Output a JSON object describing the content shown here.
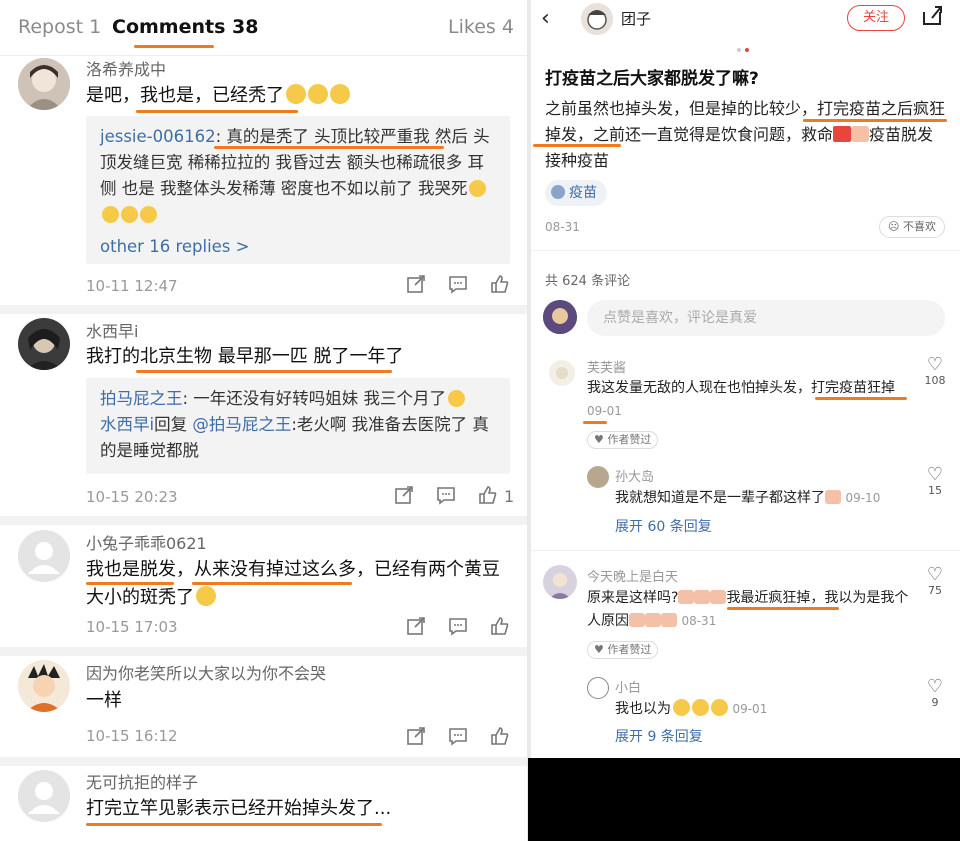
{
  "left": {
    "tabs": {
      "repost": "Repost 1",
      "comments": "Comments 38",
      "likes": "Likes 4"
    },
    "comments": [
      {
        "user": "洛希养成中",
        "text": "是吧，我也是，已经秃了",
        "reply_box": {
          "line1_user": "jessie-006162",
          "line1_text": ": 真的是秃了 头顶比较严重我 然后 头顶发缝巨宽 稀稀拉拉的 我昏过去 额头也稀疏很多 耳侧 也是 我整体头发稀薄 密度也不如以前了 我哭死",
          "more": "other 16 replies >"
        },
        "time": "10-11 12:47"
      },
      {
        "user": "水西早i",
        "text": "我打的北京生物 最早那一匹 脱了一年了",
        "reply_box": {
          "line1_user": "拍马屁之王",
          "line1_text": ": 一年还没有好转吗姐妹 我三个月了",
          "line2_user": "水西早i",
          "line2_mid": "回复",
          "line2_at": "@拍马屁之王",
          "line2_text": ":老火啊 我准备去医院了 真的是睡觉都脱"
        },
        "time": "10-15 20:23",
        "likes": "1"
      },
      {
        "user": "小兔子乖乖0621",
        "text": "我也是脱发，从来没有掉过这么多，已经有两个黄豆大小的斑秃了",
        "time": "10-15 17:03"
      },
      {
        "user": "因为你老笑所以大家以为你不会哭",
        "text": "一样",
        "time": "10-15 16:12"
      },
      {
        "user": "无可抗拒的样子",
        "text": "打完立竿见影表示已经开始掉头发了..."
      }
    ]
  },
  "right": {
    "author": "团子",
    "follow": "关注",
    "title": "打疫苗之后大家都脱发了嘛?",
    "body": "之前虽然也掉头发，但是掉的比较少，打完疫苗之后疯狂掉发，之前还一直觉得是饮食问题，救命",
    "body_tail": "疫苗脱发 接种疫苗",
    "tag": "疫苗",
    "date": "08-31",
    "dislike": "不喜欢",
    "comment_count": "共 624 条评论",
    "input_placeholder": "点赞是喜欢，评论是真爱",
    "comments": [
      {
        "user": "芙芙酱",
        "text": "我这发量无敌的人现在也怕掉头发，打完疫苗狂掉",
        "date": "09-01",
        "likes": "108",
        "chip": "作者赞过"
      },
      {
        "user": "孙大岛",
        "text": "我就想知道是不是一辈子都这样了",
        "date": "09-10",
        "likes": "15"
      },
      {
        "expand": "展开 60 条回复"
      },
      {
        "user": "今天晚上是白天",
        "text_a": "原来是这样吗?",
        "text_b": "我最近疯狂掉，我以为是我个人原因",
        "date": "08-31",
        "likes": "75",
        "chip": "作者赞过"
      },
      {
        "user": "小白",
        "text": "我也以为",
        "date": "09-01",
        "likes": "9"
      },
      {
        "expand": "展开 9 条回复"
      }
    ]
  },
  "colors": {
    "accent": "#f07a1f",
    "link": "#3f6ea7",
    "follow": "#e8453c"
  }
}
